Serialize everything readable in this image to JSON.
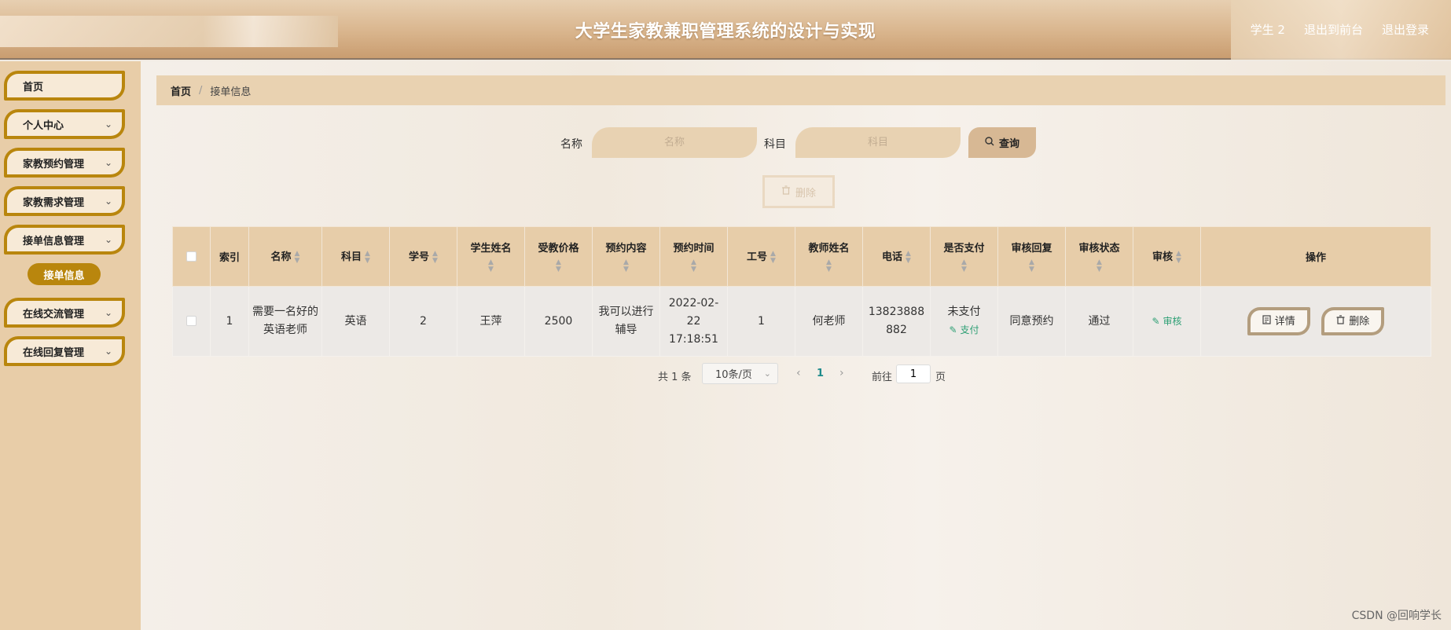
{
  "header": {
    "title": "大学生家教兼职管理系统的设计与实现",
    "user": "学生 2",
    "back_front": "退出到前台",
    "logout": "退出登录"
  },
  "sidebar": {
    "items": [
      {
        "label": "首页"
      },
      {
        "label": "个人中心"
      },
      {
        "label": "家教预约管理"
      },
      {
        "label": "家教需求管理"
      },
      {
        "label": "接单信息管理"
      },
      {
        "label": "在线交流管理"
      },
      {
        "label": "在线回复管理"
      }
    ],
    "active_sub": "接单信息"
  },
  "breadcrumb": {
    "home": "首页",
    "sep": "/",
    "current": "接单信息"
  },
  "search": {
    "name_label": "名称",
    "name_placeholder": "名称",
    "subject_label": "科目",
    "subject_placeholder": "科目",
    "query_label": "查询"
  },
  "toolbar": {
    "delete_label": "删除"
  },
  "table": {
    "headers": {
      "index": "索引",
      "name": "名称",
      "subject": "科目",
      "student_id": "学号",
      "student_name": "学生姓名",
      "price": "受教价格",
      "content": "预约内容",
      "time": "预约时间",
      "job_no": "工号",
      "teacher": "教师姓名",
      "phone": "电话",
      "paid": "是否支付",
      "reply": "审核回复",
      "status": "审核状态",
      "review": "审核",
      "ops": "操作"
    },
    "rows": [
      {
        "index": "1",
        "name": "需要一名好的英语老师",
        "subject": "英语",
        "student_id": "2",
        "student_name": "王萍",
        "price": "2500",
        "content": "我可以进行辅导",
        "time": "2022-02-22 17:18:51",
        "job_no": "1",
        "teacher": "何老师",
        "phone": "13823888882",
        "paid": "未支付",
        "pay_link": "支付",
        "reply": "同意预约",
        "status": "通过",
        "review_link": "审核",
        "detail_btn": "详情",
        "delete_btn": "删除"
      }
    ]
  },
  "pagination": {
    "total": "共 1 条",
    "page_size": "10条/页",
    "current_page": "1",
    "goto_label": "前往",
    "goto_value": "1",
    "unit": "页"
  },
  "watermark": "CSDN @回响学长"
}
